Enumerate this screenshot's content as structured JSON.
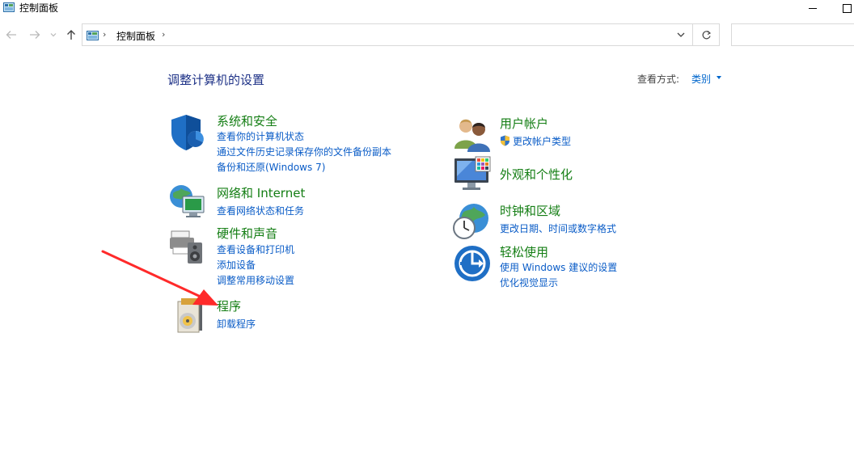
{
  "window": {
    "title": "控制面板"
  },
  "address": {
    "separator": "›",
    "path": "控制面板",
    "trail_separator": "›",
    "search_placeholder": ""
  },
  "header": {
    "title": "调整计算机的设置",
    "view_label": "查看方式:",
    "view_value": "类别"
  },
  "categories_left": [
    {
      "title": "系统和安全",
      "links": [
        "查看你的计算机状态",
        "通过文件历史记录保存你的文件备份副本",
        "备份和还原(Windows 7)"
      ]
    },
    {
      "title": "网络和 Internet",
      "links": [
        "查看网络状态和任务"
      ]
    },
    {
      "title": "硬件和声音",
      "links": [
        "查看设备和打印机",
        "添加设备",
        "调整常用移动设置"
      ]
    },
    {
      "title": "程序",
      "links": [
        "卸载程序"
      ]
    }
  ],
  "categories_right": [
    {
      "title": "用户帐户",
      "links": [
        "更改帐户类型"
      ]
    },
    {
      "title": "外观和个性化",
      "links": []
    },
    {
      "title": "时钟和区域",
      "links": [
        "更改日期、时间或数字格式"
      ]
    },
    {
      "title": "轻松使用",
      "links": [
        "使用 Windows 建议的设置",
        "优化视觉显示"
      ]
    }
  ],
  "colors": {
    "category_title": "#147e14",
    "link": "#0a5cc7",
    "heading": "#1e3287",
    "annotation_arrow": "#ff2a2a"
  },
  "icons": {
    "title": "control-panel-icon",
    "system_security": "shield-icon",
    "network": "globe-network-icon",
    "hardware": "printer-speaker-icon",
    "programs": "programs-disc-icon",
    "user_accounts": "users-icon",
    "appearance": "monitor-palette-icon",
    "clock": "clock-globe-icon",
    "ease": "ease-of-access-icon",
    "uac": "uac-shield-icon"
  }
}
